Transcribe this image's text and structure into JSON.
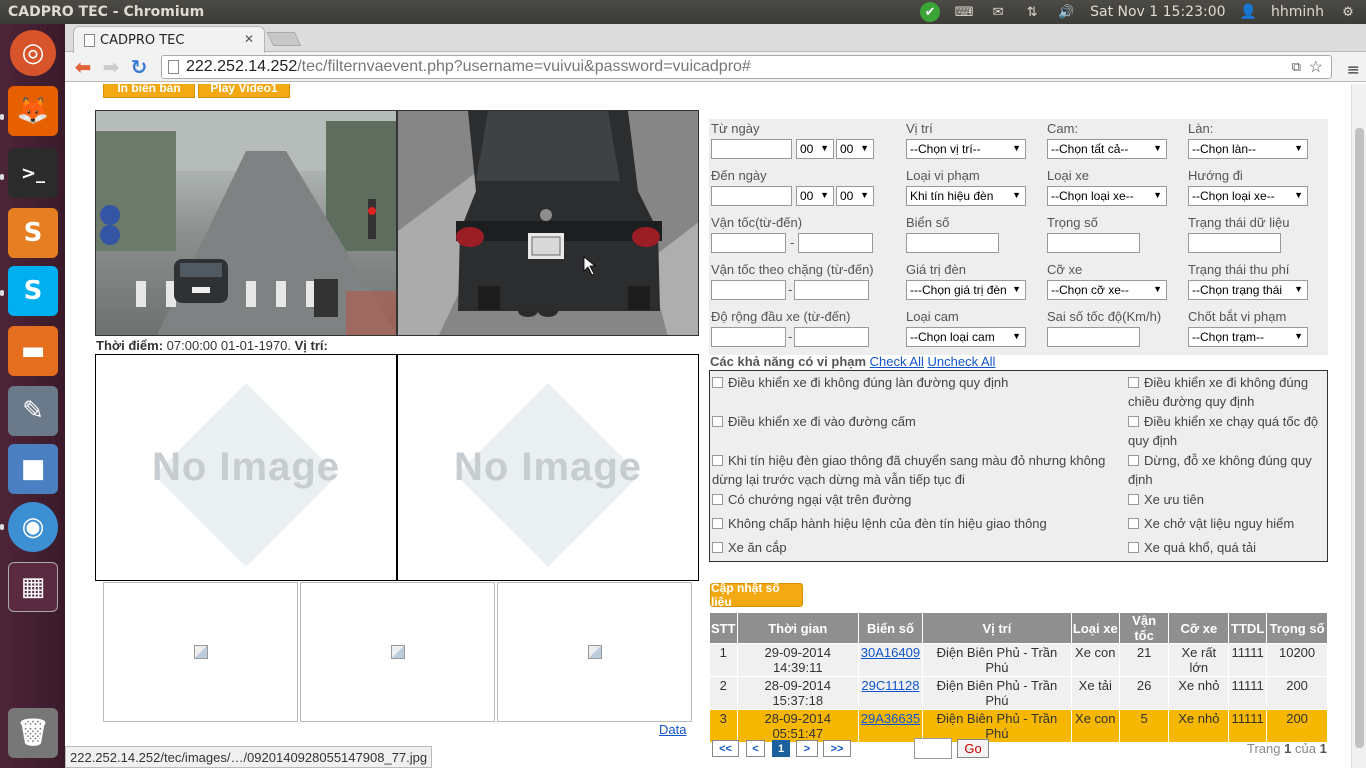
{
  "system": {
    "window_title": "CADPRO TEC - Chromium",
    "datetime": "Sat Nov  1 15:23:00",
    "user": "hhminh"
  },
  "browser": {
    "tab_title": "CADPRO TEC",
    "url_host": "222.252.14.252",
    "url_path": "/tec/filternvaevent.php?username=vuivui&password=vuicadpro#",
    "status_url": "222.252.14.252/tec/images/…/0920140928055147908_77.jpg"
  },
  "left": {
    "print_button": "In biên bản",
    "play_button": "Play Video1",
    "meta_time_label": "Thời điểm:",
    "meta_time_value": "07:00:00 01-01-1970.",
    "meta_loc_label": "Vị trí:",
    "no_image_text": "No Image",
    "data_link": "Data"
  },
  "filter": {
    "from_date": "Từ ngày",
    "to_date": "Đến ngày",
    "hour_default": "00",
    "location": "Vị trí",
    "location_sel": "--Chọn vị trí--",
    "cam": "Cam:",
    "cam_sel": "--Chọn tất cả--",
    "lane": "Làn:",
    "lane_sel": "--Chọn làn--",
    "violation_type": "Loại vi phạm",
    "violation_sel": "Khi tín hiệu đèn",
    "vehicle_type": "Loại xe",
    "vehicle_sel": "--Chọn loại xe--",
    "direction": "Hướng đi",
    "direction_sel": "--Chọn loại xe--",
    "speed": "Vận tốc(từ-đến)",
    "dash": "-",
    "plate": "Biển số",
    "weight": "Trọng số",
    "data_status": "Trạng thái dữ liệu",
    "section_speed": "Vận tốc theo chặng (từ-đến)",
    "light_value": "Giá trị đèn",
    "light_sel": "---Chọn giá trị đèn",
    "size": "Cỡ xe",
    "size_sel": "--Chọn cỡ xe--",
    "toll_status": "Trạng thái thu phí",
    "toll_sel": "--Chọn trạng thái",
    "head_width": "Độ rộng đầu xe (từ-đến)",
    "cam_type": "Loại cam",
    "cam_type_sel": "--Chọn loại cam",
    "speed_err": "Sai số tốc độ(Km/h)",
    "checkpoint": "Chốt bắt vi phạm",
    "checkpoint_sel": "--Chọn trạm--"
  },
  "violations": {
    "header": "Các khả năng có vi phạm",
    "check_all": "Check All",
    "uncheck_all": "Uncheck All",
    "items": [
      "Điều khiển xe đi không đúng làn đường quy định",
      "Điều khiển xe đi không đúng chiều đường quy định",
      "Điều khiển xe đi vào đường cấm",
      "Điều khiển xe chạy quá tốc độ quy định",
      "Khi tín hiệu đèn giao thông đã chuyển sang màu đỏ nhưng không dừng lại trước vạch dừng mà vẫn tiếp tục đi",
      "Dừng, đỗ xe không đúng quy định",
      "Có chướng ngại vật trên đường",
      "Xe ưu tiên",
      "Không chấp hành hiệu lệnh của đèn tín hiệu giao thông",
      "Xe chở vật liệu nguy hiểm",
      "Xe ăn cắp",
      "Xe quá khổ, quá tải"
    ]
  },
  "results": {
    "update_button": "Cập nhật số liệu",
    "columns": [
      "STT",
      "Thời gian",
      "Biển số",
      "Vị trí",
      "Loại xe",
      "Vận tốc",
      "Cỡ xe",
      "TTDL",
      "Trọng số"
    ],
    "rows": [
      {
        "stt": "1",
        "time": "29-09-2014 14:39:11",
        "plate": "30A16409",
        "location": "Điện Biên Phủ - Trần Phú",
        "type": "Xe con",
        "speed": "21",
        "size": "Xe rất lớn",
        "ttdl": "11111",
        "weight": "10200"
      },
      {
        "stt": "2",
        "time": "28-09-2014 15:37:18",
        "plate": "29C11128",
        "location": "Điện Biên Phủ - Trần Phú",
        "type": "Xe tải",
        "speed": "26",
        "size": "Xe nhỏ",
        "ttdl": "11111",
        "weight": "200"
      },
      {
        "stt": "3",
        "time": "28-09-2014 05:51:47",
        "plate": "29A36635",
        "location": "Điện Biên Phủ - Trần Phú",
        "type": "Xe con",
        "speed": "5",
        "size": "Xe nhỏ",
        "ttdl": "11111",
        "weight": "200"
      }
    ],
    "pager": {
      "first": "<<",
      "prev": "<",
      "current": "1",
      "next": ">",
      "last": ">>",
      "go": "Go",
      "page_label": "Trang",
      "page_num": "1",
      "of_label": "của",
      "total": "1"
    }
  }
}
